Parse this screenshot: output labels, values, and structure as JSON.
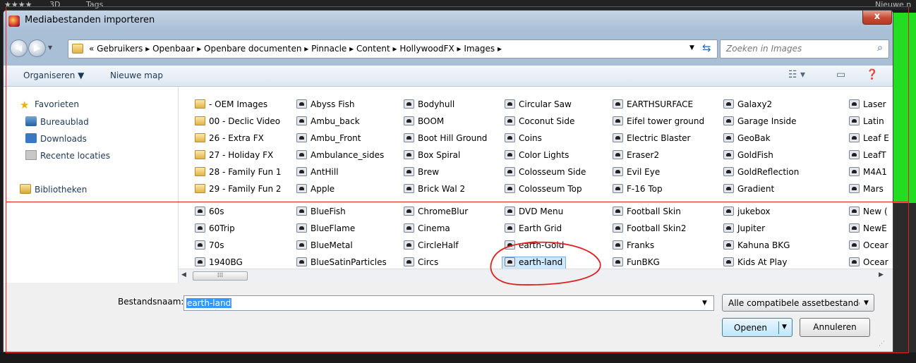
{
  "background": {
    "strip": [
      "★★★★",
      "3D",
      "Tags",
      "Nieuwe n"
    ]
  },
  "window": {
    "title": "Mediabestanden importeren",
    "close_label": "x"
  },
  "address": {
    "path": "« Gebruikers ▸ Openbaar ▸ Openbare documenten ▸ Pinnacle ▸ Content ▸ HollywoodFX ▸ Images ▸",
    "search_placeholder": "Zoeken in Images"
  },
  "toolbar": {
    "organize": "Organiseren ▼",
    "new_folder": "Nieuwe map"
  },
  "nav": {
    "favorites": "Favorieten",
    "desktop": "Bureaublad",
    "downloads": "Downloads",
    "recent": "Recente locaties",
    "libraries": "Bibliotheken"
  },
  "files": {
    "columns": [
      [
        "- OEM Images",
        "00 - Declic Video",
        "26 - Extra FX",
        "27 - Holiday FX",
        "28 - Family Fun 1",
        "29 - Family Fun 2",
        "60s",
        "60Trip",
        "70s",
        "1940BG"
      ],
      [
        "Abyss Fish",
        "Ambu_back",
        "Ambu_Front",
        "Ambulance_sides",
        "AntHill",
        "Apple",
        "BlueFish",
        "BlueFlame",
        "BlueMetal",
        "BlueSatinParticles"
      ],
      [
        "Bodyhull",
        "BOOM",
        "Boot Hill Ground",
        "Box Spiral",
        "Brew",
        "Brick Wal 2",
        "ChromeBlur",
        "Cinema",
        "CircleHalf",
        "Circs"
      ],
      [
        "Circular Saw",
        "Coconut Side",
        "Coins",
        "Color Lights",
        "Colosseum Side",
        "Colosseum Top",
        "DVD Menu",
        "Earth Grid",
        "earth-Gold",
        "earth-land"
      ],
      [
        "EARTHSURFACE",
        "Eifel tower ground",
        "Electric Blaster",
        "Eraser2",
        "Evil Eye",
        "F-16 Top",
        "Football Skin",
        "Football Skin2",
        "Franks",
        "FunBKG"
      ],
      [
        "Galaxy2",
        "Garage Inside",
        "GeoBak",
        "GoldFish",
        "GoldReflection",
        "Gradient",
        "jukebox",
        "Jupiter",
        "Kahuna BKG",
        "Kids At Play"
      ],
      [
        "Laser",
        "Latin",
        "Leaf E",
        "LeafT",
        "M4A1",
        "Mars",
        "New (",
        "NewE",
        "Ocear",
        "Ocear"
      ]
    ],
    "selected": "earth-land"
  },
  "bottom": {
    "filename_label": "Bestandsnaam:",
    "filename_value": "earth-land",
    "filter_value": "Alle compatibele assetbestande",
    "open_label": "Openen",
    "cancel_label": "Annuleren"
  },
  "colors": {
    "selection": "#cde8ff",
    "accent": "#3399ff",
    "annotation": "#e02020"
  }
}
